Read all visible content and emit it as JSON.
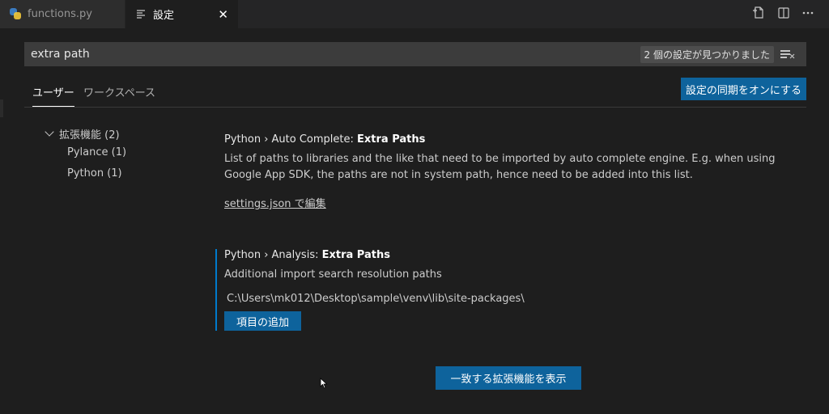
{
  "tabs": [
    {
      "label": "functions.py",
      "icon": "python-file-icon",
      "active": false
    },
    {
      "label": "設定",
      "icon": "settings-editor-icon",
      "active": true,
      "close": "✕"
    }
  ],
  "search": {
    "value": "extra path",
    "result_count": "2 個の設定が見つかりました"
  },
  "scope_tabs": [
    {
      "label": "ユーザー",
      "active": true
    },
    {
      "label": "ワークスペース",
      "active": false
    }
  ],
  "sync_button": "設定の同期をオンにする",
  "toc": {
    "group": "拡張機能 (2)",
    "items": [
      "Pylance (1)",
      "Python (1)"
    ]
  },
  "settings": [
    {
      "category": "Python › Auto Complete: ",
      "name": "Extra Paths",
      "description": "List of paths to libraries and the like that need to be imported by auto complete engine. E.g. when using Google App SDK, the paths are not in system path, hence need to be added into this list.",
      "link": "settings.json で編集"
    },
    {
      "category": "Python › Analysis: ",
      "name": "Extra Paths",
      "description": "Additional import search resolution paths",
      "value": "C:\\Users\\mk012\\Desktop\\sample\\venv\\lib\\site-packages\\",
      "add_button": "項目の追加"
    }
  ],
  "extensions_button": "一致する拡張機能を表示",
  "colors": {
    "background": "#1e1e1e",
    "button": "#0e639c",
    "focus": "#007acc"
  }
}
